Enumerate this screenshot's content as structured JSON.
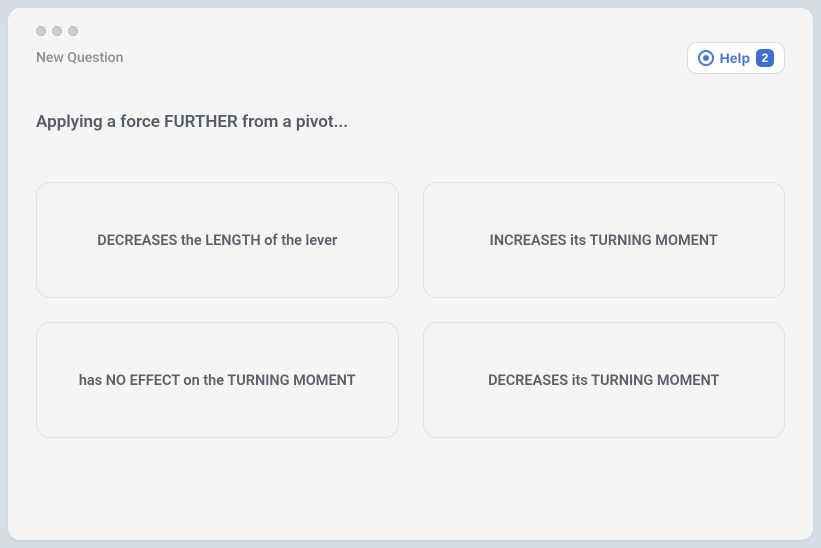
{
  "window": {
    "breadcrumb": "New Question"
  },
  "help": {
    "label": "Help",
    "badge": "2"
  },
  "question": {
    "text": "Applying a force FURTHER from a pivot..."
  },
  "answers": [
    {
      "label": "DECREASES the LENGTH of the lever"
    },
    {
      "label": "INCREASES its TURNING MOMENT"
    },
    {
      "label": "has NO EFFECT on the TURNING MOMENT"
    },
    {
      "label": "DECREASES its TURNING MOMENT"
    }
  ]
}
